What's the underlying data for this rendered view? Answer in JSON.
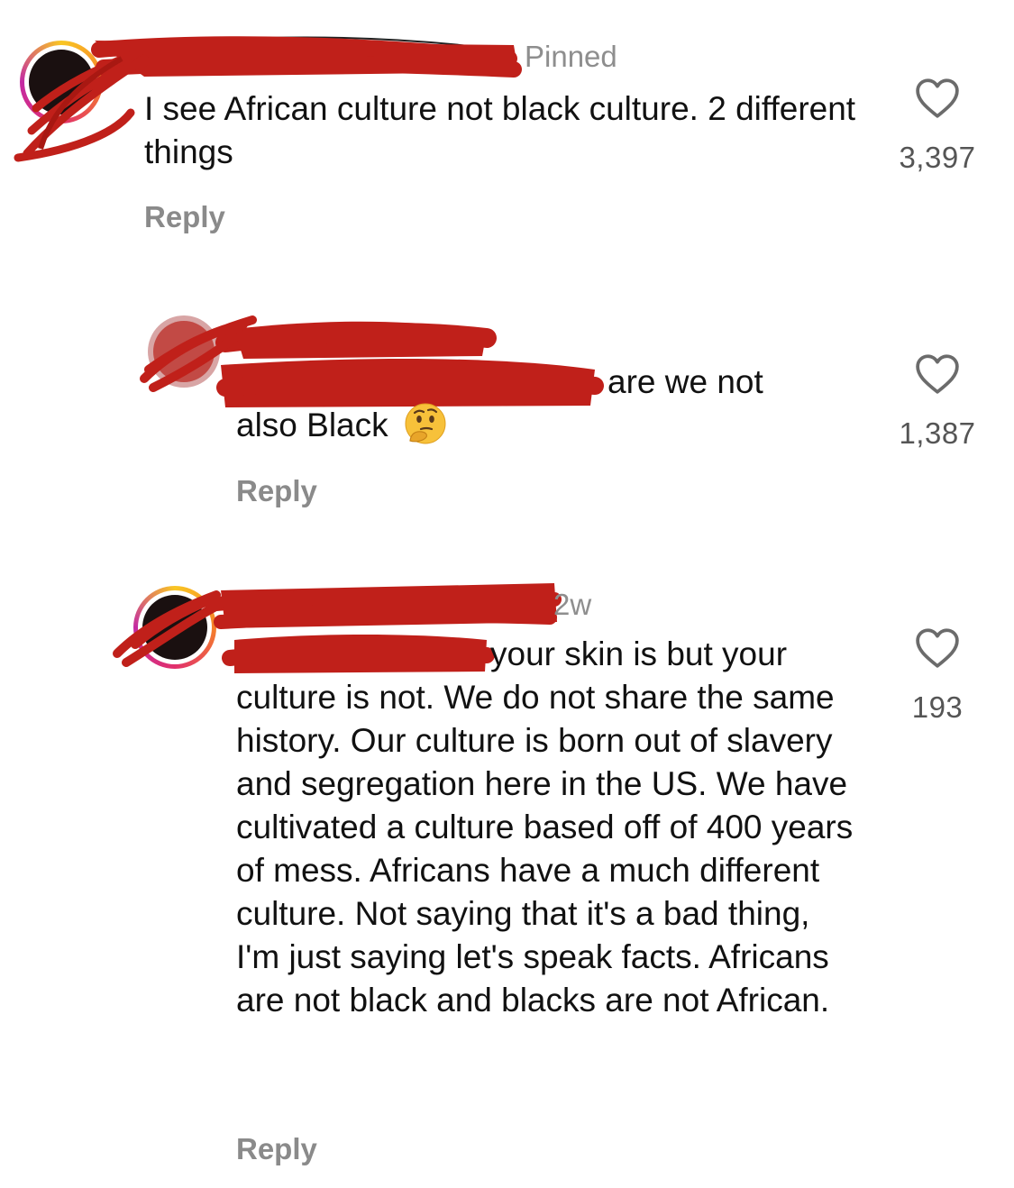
{
  "comments": [
    {
      "meta": "Pinned",
      "text": "I see African culture not black culture. 2 different things",
      "reply_label": "Reply",
      "likes": "3,397"
    },
    {
      "meta": "",
      "text_line1": "are we not",
      "text_line2": "also Black",
      "emoji": "🤔",
      "emoji_name": "thinking-face-icon",
      "reply_label": "Reply",
      "likes": "1,387"
    },
    {
      "meta": "2w",
      "text_first": "your skin is but your",
      "text_rest": "culture is not. We do not share the same history. Our culture is born out of slavery and segregation here in the US. We have cultivated a culture based off of 400 years of mess. Africans have a much different culture. Not saying that it's a bad thing, I'm just saying let's speak facts. Africans are not black and blacks are not African.",
      "reply_label": "Reply",
      "likes": "193"
    }
  ],
  "colors": {
    "redaction": "#c0201a",
    "secondary_text": "#8e8e8e",
    "reply_text": "#8a8a8a"
  }
}
